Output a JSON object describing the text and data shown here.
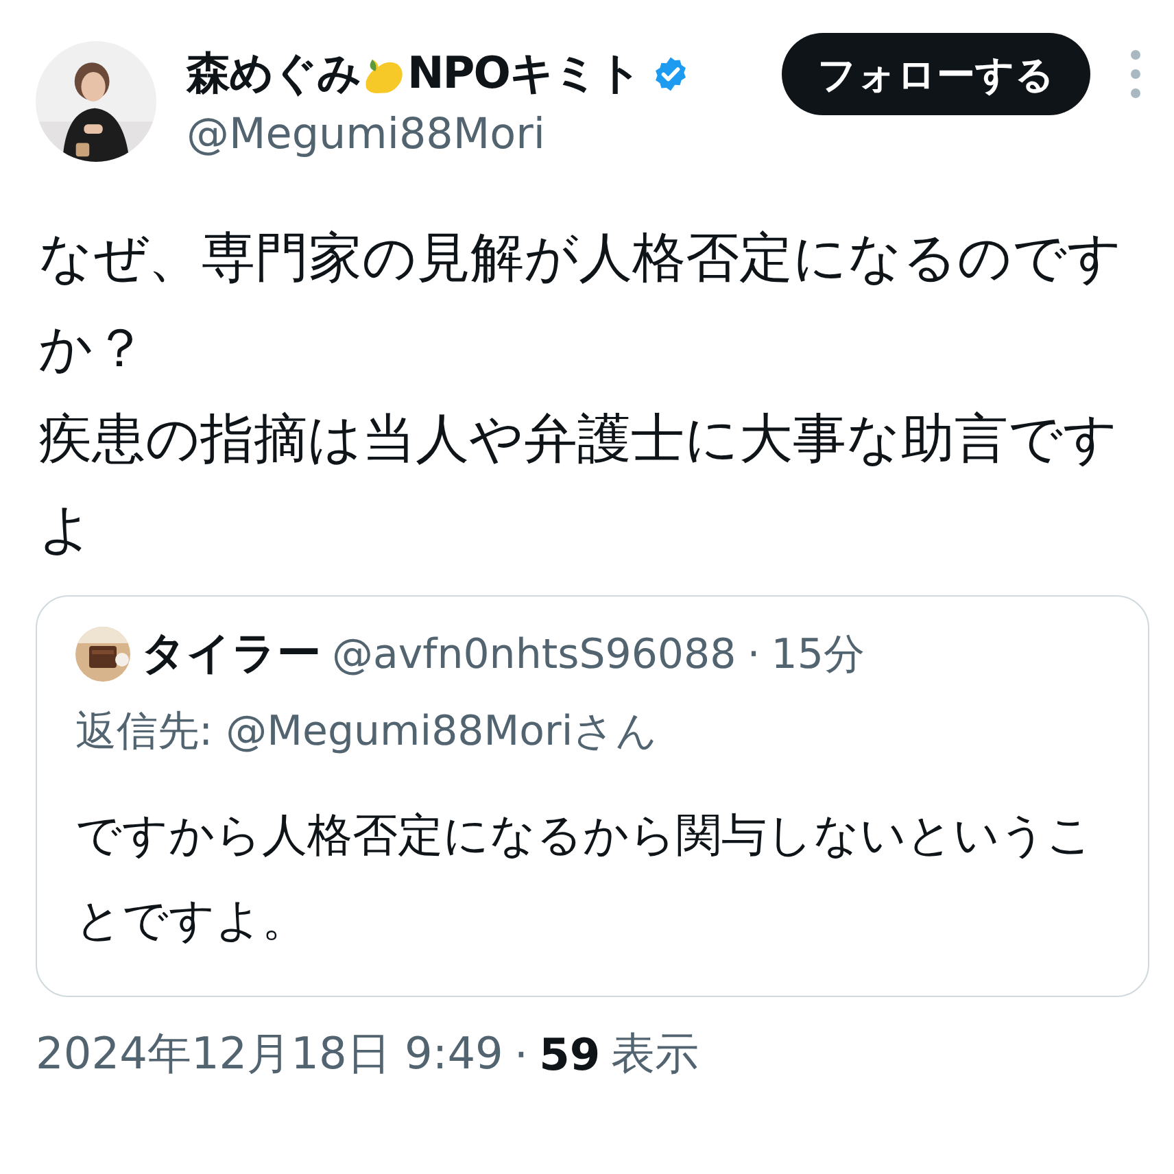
{
  "author": {
    "name": "森めぐみ",
    "name_suffix": "NPOキミト",
    "verified": true,
    "handle": "@Megumi88Mori"
  },
  "follow_button": "フォローする",
  "tweet_text": [
    "なぜ、専門家の見解が人格否定になるのですか？",
    "疾患の指摘は当人や弁護士に大事な助言ですよ"
  ],
  "quoted_tweet": {
    "name": "タイラー",
    "handle": "@avfn0nhtsS96088",
    "separator": "·",
    "time": "15分",
    "reply_to": "返信先: @Megumi88Moriさん",
    "text": "ですから人格否定になるから関与しないということですよ。"
  },
  "footer": {
    "datetime": "2024年12月18日 9:49",
    "separator": "·",
    "views": "59",
    "views_label": "表示"
  }
}
